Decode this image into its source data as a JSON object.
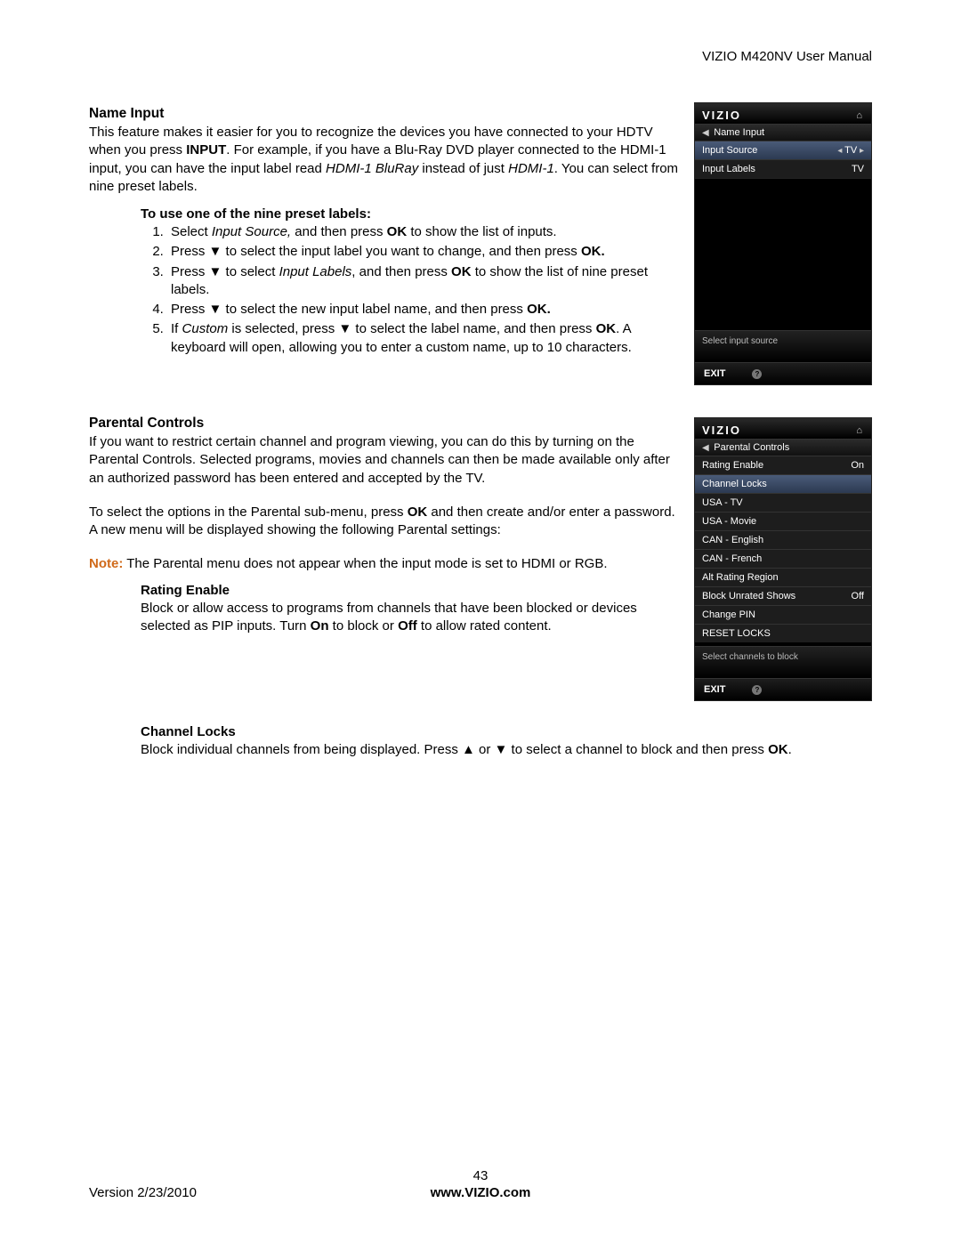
{
  "header": {
    "doc_title": "VIZIO M420NV User Manual"
  },
  "section1": {
    "title": "Name Input",
    "para": "This feature makes it easier for you to recognize the devices you have connected to your HDTV when you press ",
    "bold1": "INPUT",
    "para2": ". For example, if you have a Blu-Ray DVD player connected to the HDMI-1 input, you can have the input label read ",
    "ital1": "HDMI-1 BluRay",
    "para3": " instead of just ",
    "ital2": "HDMI-1",
    "para4": ". You can select from nine preset labels.",
    "steps_intro": "To use one of the nine preset labels:",
    "steps": {
      "s1a": "Select ",
      "s1i": "Input Source,",
      "s1b": " and then press ",
      "s1bold": "OK",
      "s1c": " to show the list of inputs.",
      "s2a": "Press ▼ to select the input label you want to change, and then press ",
      "s2bold": "OK.",
      "s3a": "Press ▼ to select ",
      "s3i": "Input Labels",
      "s3b": ", and then press ",
      "s3bold": "OK",
      "s3c": " to show the list of nine preset labels.",
      "s4a": "Press ▼ to select the new input label name, and then press ",
      "s4bold": "OK.",
      "s5a": "If ",
      "s5i": "Custom",
      "s5b": " is selected, press ▼ to select the label name, and then press ",
      "s5bold": "OK",
      "s5c": ". A keyboard will open, allowing you to enter a custom name, up to 10 characters."
    }
  },
  "section2": {
    "title": "Parental Controls",
    "p1": "If you want to restrict certain channel and program viewing, you can do this by turning on the Parental Controls. Selected programs, movies and channels can then be made available only after an authorized password has been entered and accepted by the TV.",
    "p2a": "To select the options in the Parental sub-menu, press ",
    "p2bold": "OK",
    "p2b": " and then create and/or enter a password. A new menu will be displayed showing the following Parental settings:",
    "note_label": "Note:",
    "note": " The Parental menu does not appear when the input mode is set to HDMI or RGB.",
    "rating_title": "Rating Enable",
    "rating_p_a": "Block or allow access to programs from channels that have been blocked or devices selected as PIP inputs. Turn ",
    "rating_on": "On",
    "rating_mid": " to block or ",
    "rating_off": "Off",
    "rating_end": " to allow rated content.",
    "locks_title": "Channel Locks",
    "locks_p_a": "Block individual channels from being displayed. Press ▲ or ▼ to select a channel to block and then press ",
    "locks_bold": "OK",
    "locks_end": "."
  },
  "osd1": {
    "brand": "VIZIO",
    "crumb": "Name Input",
    "r1_label": "Input Source",
    "r1_value": "TV",
    "r2_label": "Input Labels",
    "r2_value": "TV",
    "hint": "Select input source",
    "exit": "EXIT"
  },
  "osd2": {
    "brand": "VIZIO",
    "crumb": "Parental Controls",
    "rows": [
      {
        "label": "Rating Enable",
        "value": "On",
        "hl": false
      },
      {
        "label": "Channel Locks",
        "value": "",
        "hl": true
      },
      {
        "label": "USA - TV",
        "value": "",
        "hl": false
      },
      {
        "label": "USA - Movie",
        "value": "",
        "hl": false
      },
      {
        "label": "CAN - English",
        "value": "",
        "hl": false
      },
      {
        "label": "CAN - French",
        "value": "",
        "hl": false
      },
      {
        "label": "Alt Rating Region",
        "value": "",
        "hl": false
      },
      {
        "label": "Block Unrated Shows",
        "value": "Off",
        "hl": false
      },
      {
        "label": "Change PIN",
        "value": "",
        "hl": false
      },
      {
        "label": "RESET LOCKS",
        "value": "",
        "hl": false
      }
    ],
    "hint": "Select channels to block",
    "exit": "EXIT"
  },
  "footer": {
    "version": "Version 2/23/2010",
    "page": "43",
    "site": "www.VIZIO.com"
  }
}
